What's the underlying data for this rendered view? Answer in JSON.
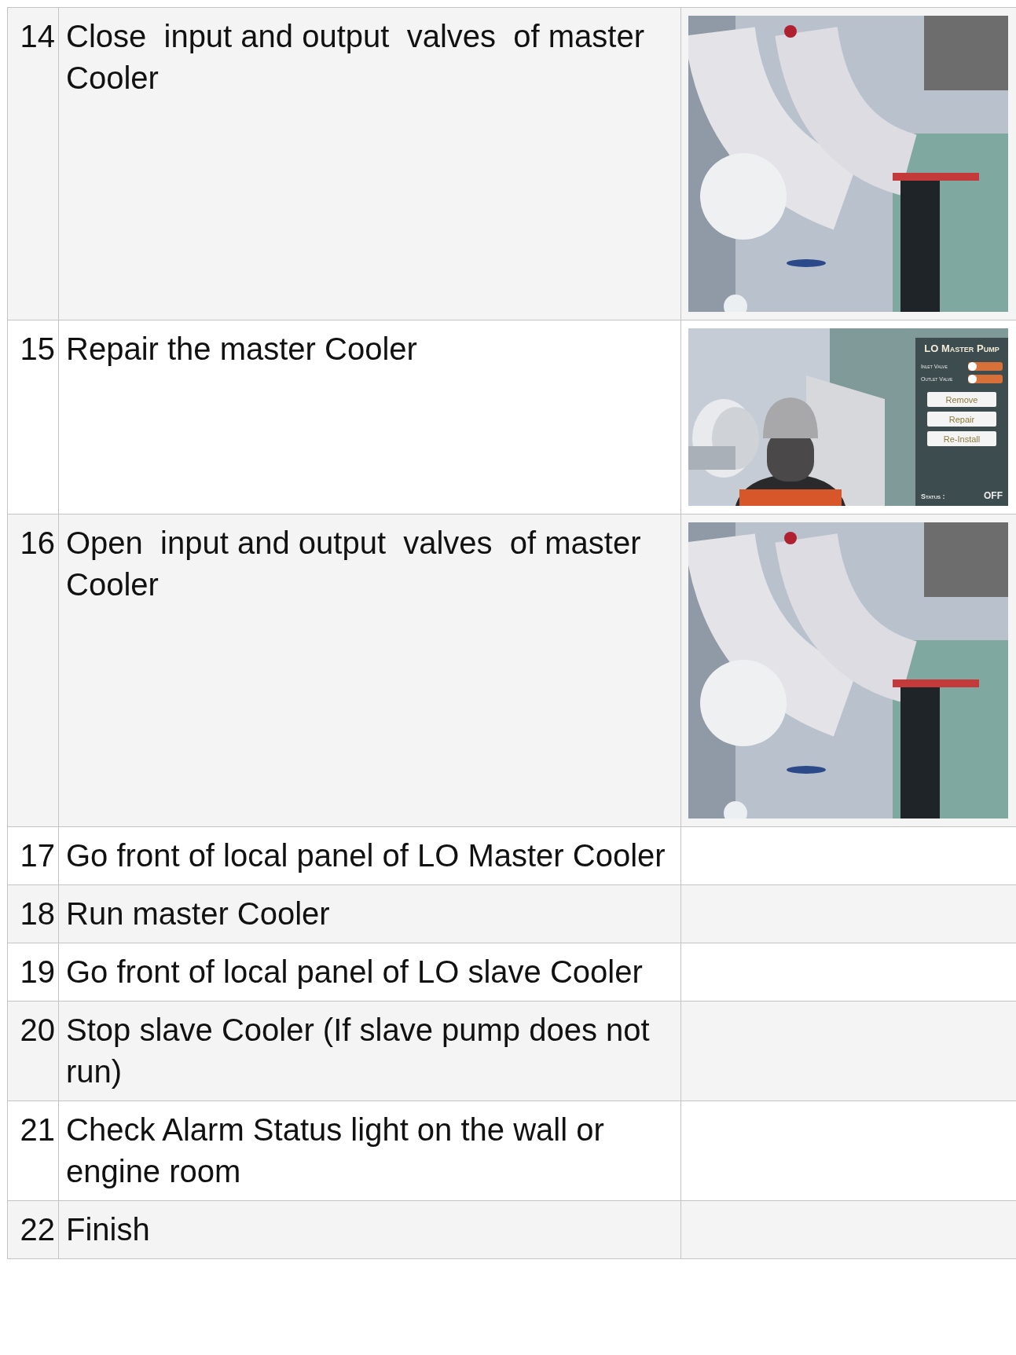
{
  "rows": [
    {
      "number": "14",
      "step": "Close  input and output  valves  of master Cooler"
    },
    {
      "number": "15",
      "step": "Repair the master Cooler",
      "image": {
        "kind": "picture",
        "panel": {
          "title": "LO Master Pump",
          "toggles": [
            {
              "label": "Inlet Valve",
              "on": false
            },
            {
              "label": "Outlet Valve",
              "on": false
            }
          ],
          "buttons": [
            "Remove",
            "Repair",
            "Re-Install"
          ],
          "status_label": "Status :",
          "status": "OFF"
        }
      }
    },
    {
      "number": "16",
      "step": "Open  input and output  valves  of master Cooler"
    },
    {
      "number": "17",
      "step": "Go front of local panel of LO Master Cooler"
    },
    {
      "number": "18",
      "step": "Run master Cooler"
    },
    {
      "number": "19",
      "step": "Go front of local panel of LO slave Cooler"
    },
    {
      "number": "20",
      "step": "Stop slave Cooler (If slave pump does not run)"
    },
    {
      "number": "21",
      "step": "Check Alarm Status light on the wall or engine room"
    },
    {
      "number": "22",
      "step": "Finish"
    }
  ]
}
